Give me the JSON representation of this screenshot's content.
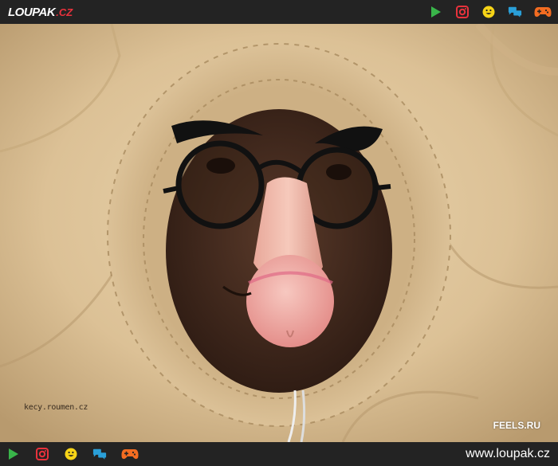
{
  "header": {
    "logo_main": "LOUPAK",
    "logo_tld": ".CZ",
    "icons": [
      "play-icon",
      "instagram-icon",
      "smiley-icon",
      "chat-icon",
      "gamepad-icon"
    ]
  },
  "photo": {
    "watermark_left": "kecy.roumen.cz",
    "watermark_right": "FEELS.RU"
  },
  "footer": {
    "icons": [
      "play-icon",
      "instagram-icon",
      "smiley-icon",
      "chat-icon",
      "gamepad-icon"
    ],
    "site_url": "www.loupak.cz"
  },
  "colors": {
    "bar_bg": "#232323",
    "accent_red": "#e8323c",
    "play_green": "#39b54a",
    "smiley_yellow": "#f7d417",
    "chat_blue": "#2a9fd8",
    "gamepad_orange": "#f36c21"
  }
}
